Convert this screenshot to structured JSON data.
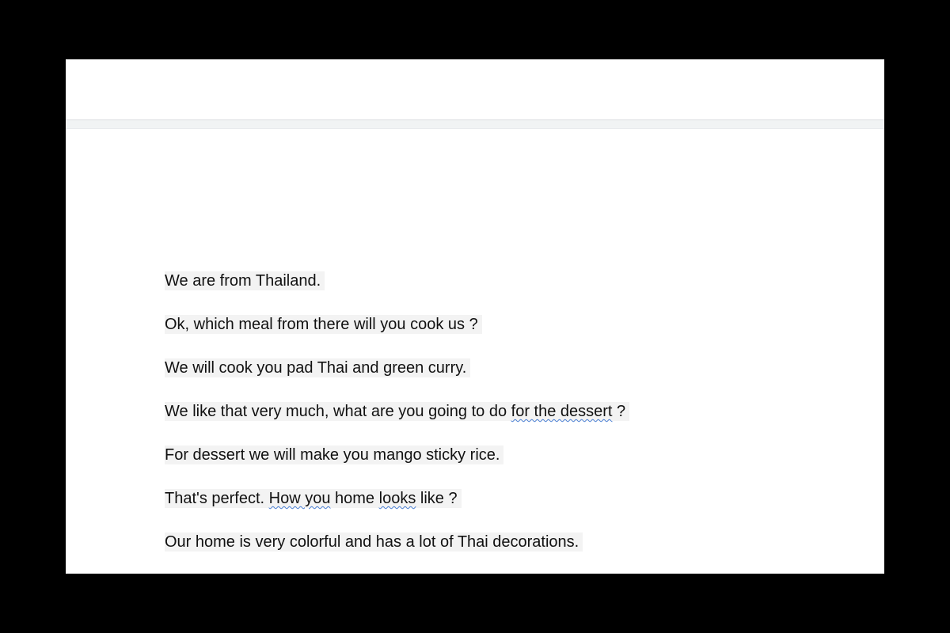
{
  "document": {
    "lines": [
      {
        "segments": [
          {
            "text": "We are from Thailand.",
            "flag": false
          }
        ]
      },
      {
        "segments": [
          {
            "text": "Ok, which meal from there will you cook us ?",
            "flag": false
          }
        ]
      },
      {
        "segments": [
          {
            "text": "We will cook you pad Thai and green curry.",
            "flag": false
          }
        ]
      },
      {
        "segments": [
          {
            "text": "We like that very much, what are you going to do ",
            "flag": false
          },
          {
            "text": "for the dessert",
            "flag": true
          },
          {
            "text": " ?",
            "flag": false
          }
        ]
      },
      {
        "segments": [
          {
            "text": "For dessert we will make you mango sticky rice.",
            "flag": false
          }
        ]
      },
      {
        "segments": [
          {
            "text": "That's perfect. ",
            "flag": false
          },
          {
            "text": "How you",
            "flag": true
          },
          {
            "text": " home ",
            "flag": false
          },
          {
            "text": "looks",
            "flag": true
          },
          {
            "text": " like ?",
            "flag": false
          }
        ]
      },
      {
        "segments": [
          {
            "text": "Our home is very colorful and has a lot of Thai decorations.",
            "flag": false
          }
        ]
      }
    ]
  },
  "colors": {
    "text": "#111111",
    "highlight": "#f3f3f3",
    "spellcheck_underline": "#4a7fd4",
    "background": "#000000",
    "page": "#ffffff"
  }
}
